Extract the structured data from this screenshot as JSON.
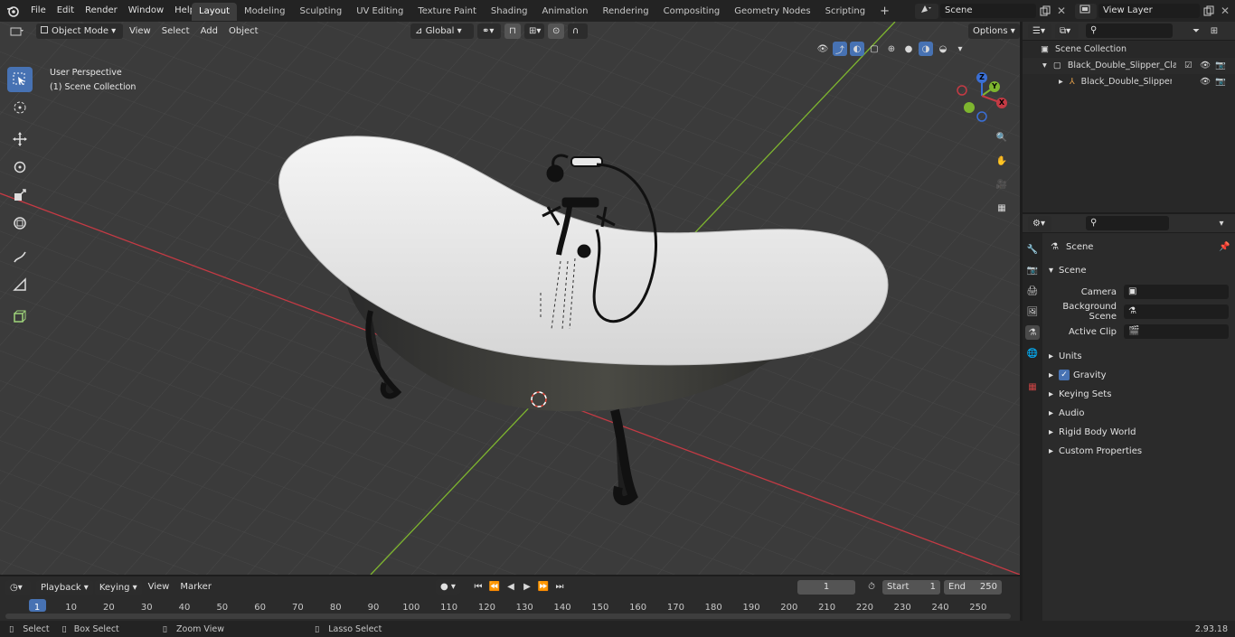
{
  "topbar": {
    "menus": [
      "File",
      "Edit",
      "Render",
      "Window",
      "Help"
    ],
    "workspaces": [
      "Layout",
      "Modeling",
      "Sculpting",
      "UV Editing",
      "Texture Paint",
      "Shading",
      "Animation",
      "Rendering",
      "Compositing",
      "Geometry Nodes",
      "Scripting"
    ],
    "active_workspace": "Layout",
    "add_tab": "+",
    "scene_name": "Scene",
    "view_layer": "View Layer"
  },
  "viewport_header": {
    "mode": "Object Mode",
    "menus": [
      "View",
      "Select",
      "Add",
      "Object"
    ],
    "orientation": "Global",
    "options": "Options"
  },
  "viewport": {
    "perspective": "User Perspective",
    "collection": "(1) Scene Collection",
    "gizmo": {
      "z": "Z",
      "y": "Y",
      "x": "X"
    }
  },
  "outliner": {
    "root": "Scene Collection",
    "items": [
      "Black_Double_Slipper_Clawfo",
      "Black_Double_Slipper_Cl"
    ]
  },
  "properties": {
    "context": "Scene",
    "panel_title": "Scene",
    "fields": [
      {
        "label": "Camera",
        "value": ""
      },
      {
        "label": "Background Scene",
        "value": ""
      },
      {
        "label": "Active Clip",
        "value": ""
      }
    ],
    "subpanels": [
      "Units",
      "Gravity",
      "Keying Sets",
      "Audio",
      "Rigid Body World",
      "Custom Properties"
    ],
    "gravity_checked": true
  },
  "timeline": {
    "menus": [
      "Playback",
      "Keying",
      "View",
      "Marker"
    ],
    "current_frame": "1",
    "start_label": "Start",
    "start": "1",
    "end_label": "End",
    "end": "250",
    "ticks": [
      "1",
      "10",
      "20",
      "30",
      "40",
      "50",
      "60",
      "70",
      "80",
      "90",
      "100",
      "110",
      "120",
      "130",
      "140",
      "150",
      "160",
      "170",
      "180",
      "190",
      "200",
      "210",
      "220",
      "230",
      "240",
      "250"
    ]
  },
  "statusbar": {
    "select": "Select",
    "box_select": "Box Select",
    "zoom_view": "Zoom View",
    "lasso_select": "Lasso Select",
    "version": "2.93.18"
  },
  "colors": {
    "accent": "#4772b3",
    "x_axis": "#c43a44",
    "y_axis": "#7eb52f",
    "z_axis": "#3a6fd6"
  }
}
